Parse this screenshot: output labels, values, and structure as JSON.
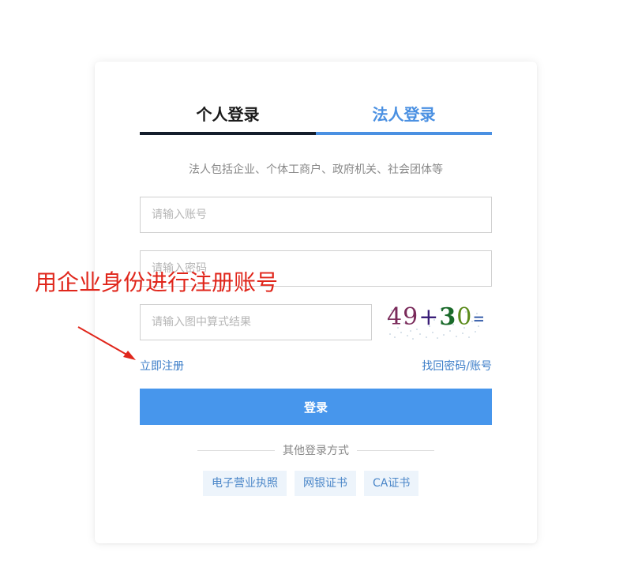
{
  "tabs": {
    "personal": "个人登录",
    "legal": "法人登录"
  },
  "subtitle": "法人包括企业、个体工商户、政府机关、社会团体等",
  "fields": {
    "account_placeholder": "请输入账号",
    "password_placeholder": "请输入密码",
    "captcha_placeholder": "请输入图中算式结果"
  },
  "captcha": {
    "text": "49+30=?"
  },
  "links": {
    "register": "立即注册",
    "forgot": "找回密码/账号"
  },
  "login_button": "登录",
  "other_methods": {
    "label": "其他登录方式",
    "items": [
      "电子营业执照",
      "网银证书",
      "CA证书"
    ]
  },
  "annotation": {
    "text": "用企业身份进行注册账号"
  },
  "colors": {
    "accent": "#4a90e2",
    "login_button": "#4796ec",
    "annotation": "#e0261b",
    "active_tab_underline": "#141d2b"
  }
}
